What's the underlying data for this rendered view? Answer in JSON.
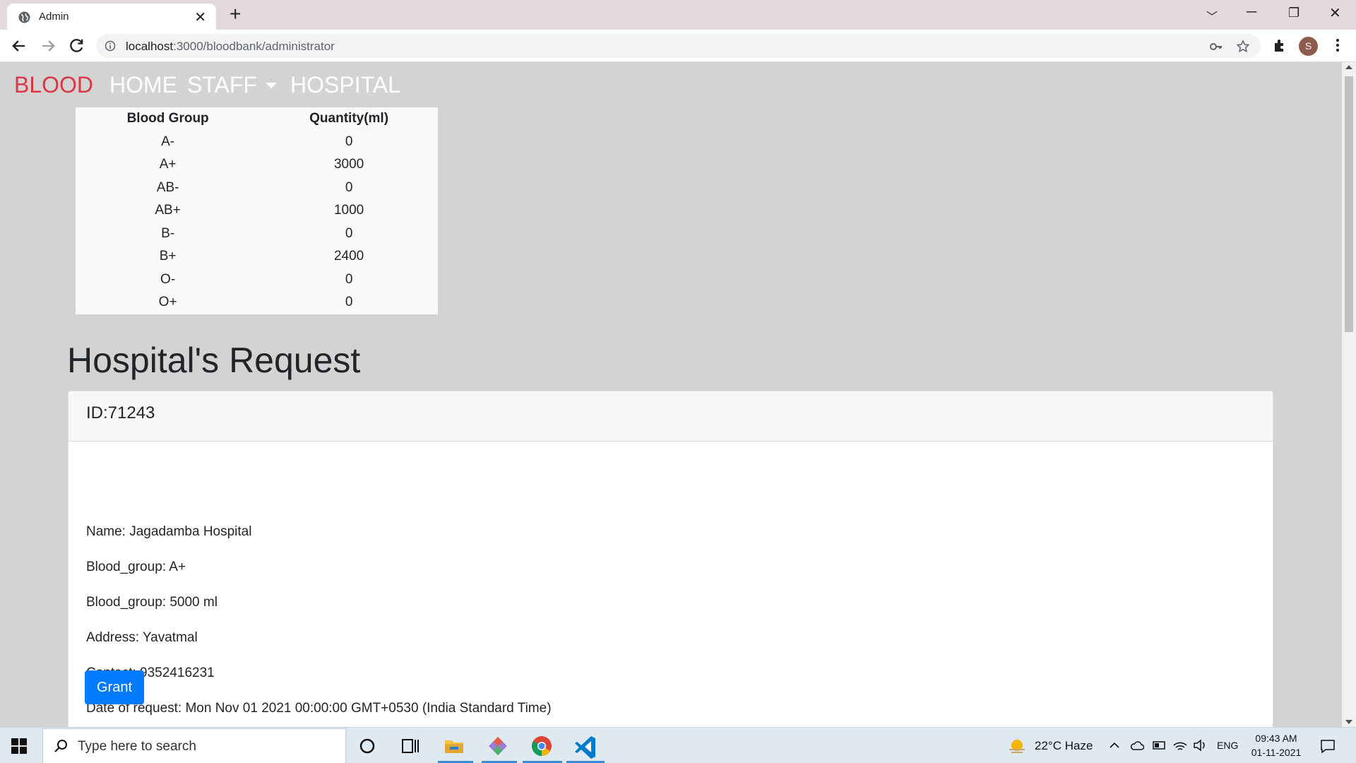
{
  "browser": {
    "tab_title": "Admin",
    "tab_close": "✕",
    "new_tab": "+",
    "url_host": "localhost",
    "url_rest": ":3000/bloodbank/administrator",
    "avatar_letter": "S",
    "window_controls": [
      "﹀",
      "─",
      "❐",
      "✕"
    ]
  },
  "navbar": {
    "brand": "BLOOD",
    "items": [
      "HOME",
      "STAFF",
      "HOSPITAL"
    ],
    "brand_color": "#dc3545"
  },
  "stock": {
    "headers": [
      "Blood Group",
      "Quantity(ml)"
    ],
    "rows": [
      {
        "group": "A-",
        "qty": "0"
      },
      {
        "group": "A+",
        "qty": "3000"
      },
      {
        "group": "AB-",
        "qty": "0"
      },
      {
        "group": "AB+",
        "qty": "1000"
      },
      {
        "group": "B-",
        "qty": "0"
      },
      {
        "group": "B+",
        "qty": "2400"
      },
      {
        "group": "O-",
        "qty": "0"
      },
      {
        "group": "O+",
        "qty": "0"
      }
    ]
  },
  "requests": {
    "title": "Hospital's Request",
    "card": {
      "id": "ID:71243",
      "name": "Name: Jagadamba Hospital",
      "blood_group": "Blood_group: A+",
      "quantity": "Blood_group: 5000 ml",
      "address": "Address: Yavatmal",
      "contact": "Contact: 9352416231",
      "date": "Date of request: Mon Nov 01 2021 00:00:00 GMT+0530 (India Standard Time)",
      "grant_label": "Grant"
    }
  },
  "taskbar": {
    "search_placeholder": "Type here to search",
    "weather": "22°C  Haze",
    "language": "ENG",
    "time": "09:43 AM",
    "date": "01-11-2021",
    "accent": "#007bff"
  }
}
